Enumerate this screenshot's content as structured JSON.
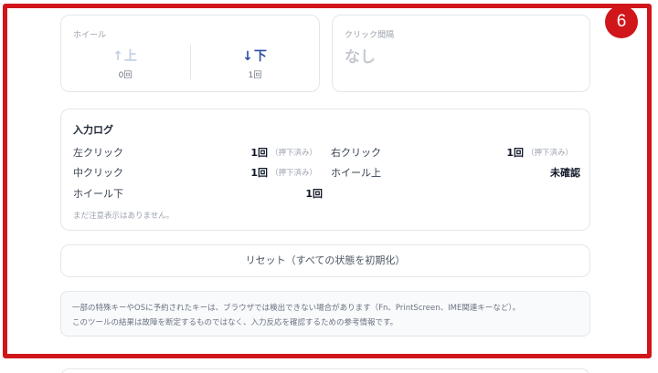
{
  "wheel": {
    "label": "ホイール",
    "up": {
      "label": "↑上",
      "count": "0回",
      "active": false
    },
    "down": {
      "label": "↓下",
      "count": "1回",
      "active": true
    }
  },
  "click_interval": {
    "label": "クリック間隔",
    "value": "なし"
  },
  "input_log": {
    "title": "入力ログ",
    "rows": [
      {
        "label": "左クリック",
        "count": "1回",
        "note": "（押下済み）"
      },
      {
        "label": "右クリック",
        "count": "1回",
        "note": "（押下済み）"
      },
      {
        "label": "中クリック",
        "count": "1回",
        "note": "（押下済み）"
      },
      {
        "label": "ホイール上",
        "count": "未確認",
        "note": ""
      },
      {
        "label": "ホイール下",
        "count": "1回",
        "note": ""
      }
    ],
    "footer": "まだ注意表示はありません。"
  },
  "reset_button": {
    "label": "リセット（すべての状態を初期化）"
  },
  "notice": {
    "line1": "一部の特殊キーやOSに予約されたキーは、ブラウザでは検出できない場合があります（Fn、PrintScreen、IME関連キーなど）。",
    "line2": "このツールの結果は故障を断定するものではなく、入力反応を確認するための参考情報です。"
  },
  "annotation": {
    "marker_number": "6",
    "color": "#d0161b"
  },
  "colors": {
    "accent": "#2c4fa3",
    "inactive": "#c2d0e4",
    "border": "#e3e6ea"
  }
}
